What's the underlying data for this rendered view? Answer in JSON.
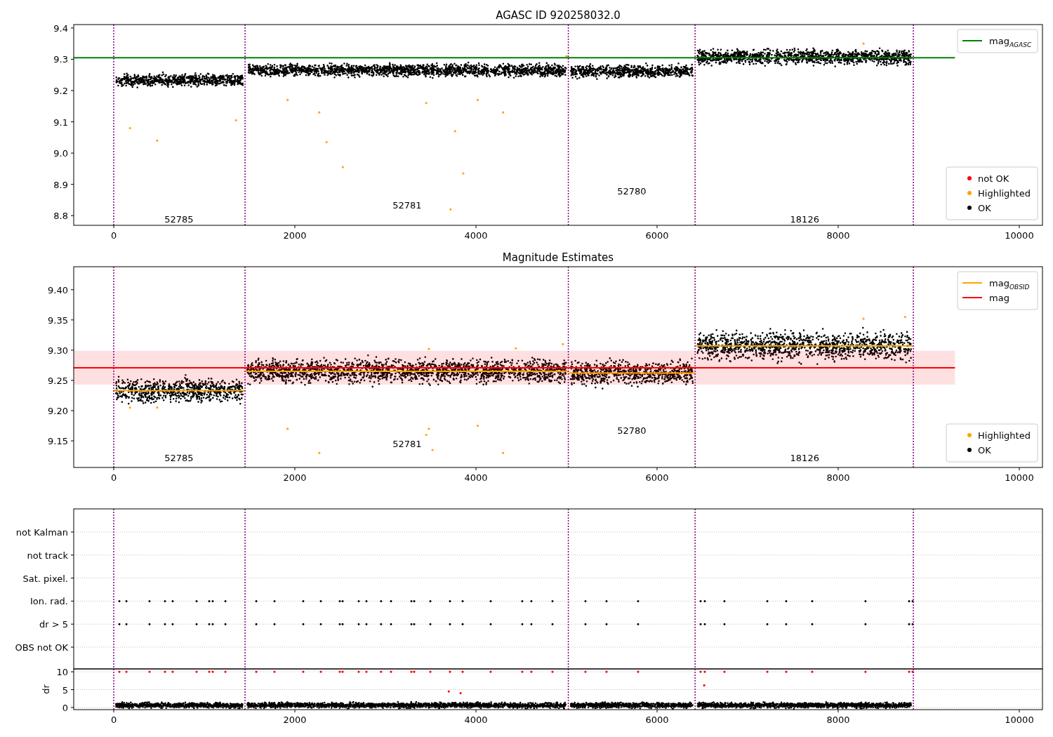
{
  "panels": [
    {
      "chart_data": {
        "type": "line",
        "title": "AGASC ID 920258032.0",
        "xlim": [
          -442,
          10256
        ],
        "ylim": [
          8.769,
          9.411
        ],
        "xticks": [
          0,
          2000,
          4000,
          6000,
          8000,
          10000
        ],
        "yticks": [
          {
            "value": 8.8,
            "label": "8.8"
          },
          {
            "value": 8.9,
            "label": "8.9"
          },
          {
            "value": 9.0,
            "label": "9.0"
          },
          {
            "value": 9.1,
            "label": "9.1"
          },
          {
            "value": 9.2,
            "label": "9.2"
          },
          {
            "value": 9.3,
            "label": "9.3"
          },
          {
            "value": 9.4,
            "label": "9.4"
          }
        ],
        "legend": true,
        "series": [
          {
            "name": "mag$_{AGASC}$",
            "color": "#008000",
            "x": [
              -442,
              9290
            ],
            "values": [
              9.305,
              9.305
            ]
          },
          {
            "name": "Highlighted",
            "type": "scatter",
            "color": "#ffa500",
            "x": [
              180,
              480,
              1350,
              1920,
              2270,
              2350,
              2530,
              3450,
              3720,
              3770,
              3860,
              4020,
              4300,
              5000,
              8280
            ],
            "values": [
              9.08,
              9.04,
              9.105,
              9.17,
              9.13,
              9.035,
              8.955,
              9.16,
              8.82,
              9.07,
              8.935,
              9.17,
              9.13,
              9.31,
              9.35
            ]
          }
        ],
        "ref_lines": [
          {
            "axis": "x",
            "value": 0,
            "color": "#800080"
          },
          {
            "axis": "x",
            "value": 1450,
            "color": "#800080"
          },
          {
            "axis": "x",
            "value": 5020,
            "color": "#800080"
          },
          {
            "axis": "x",
            "value": 6420,
            "color": "#800080"
          },
          {
            "axis": "x",
            "value": 8830,
            "color": "#800080"
          }
        ],
        "annotations": [
          "52785",
          "52781",
          "52780",
          "18126"
        ]
      },
      "point_legend": [
        {
          "kind": "entry",
          "label": "not OK",
          "color": "#ff0000"
        },
        {
          "kind": "series"
        },
        {
          "kind": "entry",
          "label": "OK",
          "color": "#000000"
        }
      ]
    },
    {
      "chart_data": {
        "type": "line",
        "title": "Magnitude Estimates",
        "xlim": [
          -442,
          10256
        ],
        "ylim": [
          9.106,
          9.438
        ],
        "xticks": [
          0,
          2000,
          4000,
          6000,
          8000,
          10000
        ],
        "yticks": [
          {
            "value": 9.15,
            "label": "9.15"
          },
          {
            "value": 9.2,
            "label": "9.20"
          },
          {
            "value": 9.25,
            "label": "9.25"
          },
          {
            "value": 9.3,
            "label": "9.30"
          },
          {
            "value": 9.35,
            "label": "9.35"
          },
          {
            "value": 9.4,
            "label": "9.40"
          }
        ],
        "legend": true,
        "series": [
          {
            "name": "mag$_{OBSID}$",
            "color": "#ffa500",
            "x": [
              0,
              1450
            ],
            "values": [
              9.233,
              9.233
            ]
          },
          {
            "color": "#ffa500",
            "x": [
              1450,
              5020
            ],
            "values": [
              9.265,
              9.265
            ]
          },
          {
            "color": "#ffa500",
            "x": [
              5020,
              6420
            ],
            "values": [
              9.262,
              9.262
            ]
          },
          {
            "color": "#ffa500",
            "x": [
              6420,
              8830
            ],
            "values": [
              9.307,
              9.307
            ]
          },
          {
            "name": "mag",
            "color": "#ff0000",
            "x": [
              -442,
              9290
            ],
            "values": [
              9.271,
              9.271
            ]
          },
          {
            "name": "Highlighted",
            "type": "scatter",
            "color": "#ffa500",
            "x": [
              180,
              480,
              1920,
              2270,
              3450,
              3480,
              3520,
              4020,
              4300,
              3480,
              4440,
              4960,
              8280,
              8740
            ],
            "values": [
              9.205,
              9.205,
              9.17,
              9.13,
              9.16,
              9.17,
              9.135,
              9.175,
              9.13,
              9.302,
              9.303,
              9.31,
              9.352,
              9.355
            ]
          }
        ],
        "bands": [
          {
            "axis": "y",
            "from": 9.243,
            "to": 9.299,
            "color": "#ff0000"
          }
        ],
        "ref_lines": [
          {
            "axis": "x",
            "value": 0,
            "color": "#800080"
          },
          {
            "axis": "x",
            "value": 1450,
            "color": "#800080"
          },
          {
            "axis": "x",
            "value": 5020,
            "color": "#800080"
          },
          {
            "axis": "x",
            "value": 6420,
            "color": "#800080"
          },
          {
            "axis": "x",
            "value": 8830,
            "color": "#800080"
          }
        ],
        "annotations": [
          "52785",
          "52781",
          "52780",
          "18126"
        ]
      },
      "point_legend": [
        {
          "kind": "series"
        },
        {
          "kind": "entry",
          "label": "OK",
          "color": "#000000"
        }
      ]
    },
    {
      "flag_labels": [
        "not Kalman",
        "not track",
        "Sat. pixel.",
        "Ion. rad.",
        "dr > 5",
        "OBS not OK"
      ]
    },
    {
      "chart_data": {
        "type": "scatter",
        "ylabel": "dr",
        "xlim": [
          -442,
          10256
        ],
        "ylim": [
          -0.6,
          10.8
        ],
        "xticks": [
          0,
          2000,
          4000,
          6000,
          8000,
          10000
        ],
        "yticks": [
          0,
          5,
          10
        ],
        "grid": true,
        "series": [
          {
            "color": "#ff0000",
            "x": [
              62,
              140,
              395,
              566,
              651,
              915,
              1054,
              1093,
              1233,
              1574,
              1775,
              2093,
              2287,
              2496,
              2527,
              2705,
              2791,
              2953,
              3062,
              3287,
              3318,
              3496,
              3713,
              3853,
              4163,
              4512,
              4612,
              4845,
              5209,
              5442,
              5791,
              6481,
              6527,
              6744,
              7217,
              7426,
              7713,
              8302,
              8783,
              8822,
              3700,
              3830,
              6520
            ],
            "values": [
              10,
              10,
              10,
              10,
              10,
              10,
              10,
              10,
              10,
              10,
              10,
              10,
              10,
              10,
              10,
              10,
              10,
              10,
              10,
              10,
              10,
              10,
              10,
              10,
              10,
              10,
              10,
              10,
              10,
              10,
              10,
              10,
              10,
              10,
              10,
              10,
              10,
              10,
              10,
              10,
              4.5,
              4.0,
              6.2
            ]
          }
        ],
        "ref_lines": [
          {
            "axis": "x",
            "value": 0,
            "color": "#800080"
          },
          {
            "axis": "x",
            "value": 1450,
            "color": "#800080"
          },
          {
            "axis": "x",
            "value": 5020,
            "color": "#800080"
          },
          {
            "axis": "x",
            "value": 6420,
            "color": "#800080"
          },
          {
            "axis": "x",
            "value": 8830,
            "color": "#800080"
          }
        ]
      }
    }
  ]
}
